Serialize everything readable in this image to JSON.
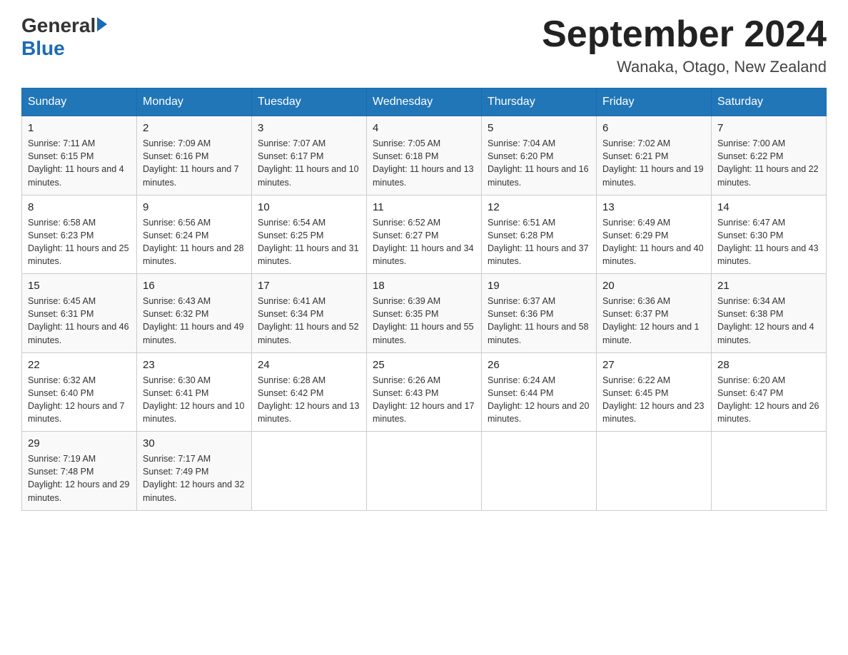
{
  "header": {
    "logo_general": "General",
    "logo_blue": "Blue",
    "month_year": "September 2024",
    "location": "Wanaka, Otago, New Zealand"
  },
  "days_of_week": [
    "Sunday",
    "Monday",
    "Tuesday",
    "Wednesday",
    "Thursday",
    "Friday",
    "Saturday"
  ],
  "weeks": [
    [
      {
        "day": "1",
        "sunrise": "7:11 AM",
        "sunset": "6:15 PM",
        "daylight": "11 hours and 4 minutes."
      },
      {
        "day": "2",
        "sunrise": "7:09 AM",
        "sunset": "6:16 PM",
        "daylight": "11 hours and 7 minutes."
      },
      {
        "day": "3",
        "sunrise": "7:07 AM",
        "sunset": "6:17 PM",
        "daylight": "11 hours and 10 minutes."
      },
      {
        "day": "4",
        "sunrise": "7:05 AM",
        "sunset": "6:18 PM",
        "daylight": "11 hours and 13 minutes."
      },
      {
        "day": "5",
        "sunrise": "7:04 AM",
        "sunset": "6:20 PM",
        "daylight": "11 hours and 16 minutes."
      },
      {
        "day": "6",
        "sunrise": "7:02 AM",
        "sunset": "6:21 PM",
        "daylight": "11 hours and 19 minutes."
      },
      {
        "day": "7",
        "sunrise": "7:00 AM",
        "sunset": "6:22 PM",
        "daylight": "11 hours and 22 minutes."
      }
    ],
    [
      {
        "day": "8",
        "sunrise": "6:58 AM",
        "sunset": "6:23 PM",
        "daylight": "11 hours and 25 minutes."
      },
      {
        "day": "9",
        "sunrise": "6:56 AM",
        "sunset": "6:24 PM",
        "daylight": "11 hours and 28 minutes."
      },
      {
        "day": "10",
        "sunrise": "6:54 AM",
        "sunset": "6:25 PM",
        "daylight": "11 hours and 31 minutes."
      },
      {
        "day": "11",
        "sunrise": "6:52 AM",
        "sunset": "6:27 PM",
        "daylight": "11 hours and 34 minutes."
      },
      {
        "day": "12",
        "sunrise": "6:51 AM",
        "sunset": "6:28 PM",
        "daylight": "11 hours and 37 minutes."
      },
      {
        "day": "13",
        "sunrise": "6:49 AM",
        "sunset": "6:29 PM",
        "daylight": "11 hours and 40 minutes."
      },
      {
        "day": "14",
        "sunrise": "6:47 AM",
        "sunset": "6:30 PM",
        "daylight": "11 hours and 43 minutes."
      }
    ],
    [
      {
        "day": "15",
        "sunrise": "6:45 AM",
        "sunset": "6:31 PM",
        "daylight": "11 hours and 46 minutes."
      },
      {
        "day": "16",
        "sunrise": "6:43 AM",
        "sunset": "6:32 PM",
        "daylight": "11 hours and 49 minutes."
      },
      {
        "day": "17",
        "sunrise": "6:41 AM",
        "sunset": "6:34 PM",
        "daylight": "11 hours and 52 minutes."
      },
      {
        "day": "18",
        "sunrise": "6:39 AM",
        "sunset": "6:35 PM",
        "daylight": "11 hours and 55 minutes."
      },
      {
        "day": "19",
        "sunrise": "6:37 AM",
        "sunset": "6:36 PM",
        "daylight": "11 hours and 58 minutes."
      },
      {
        "day": "20",
        "sunrise": "6:36 AM",
        "sunset": "6:37 PM",
        "daylight": "12 hours and 1 minute."
      },
      {
        "day": "21",
        "sunrise": "6:34 AM",
        "sunset": "6:38 PM",
        "daylight": "12 hours and 4 minutes."
      }
    ],
    [
      {
        "day": "22",
        "sunrise": "6:32 AM",
        "sunset": "6:40 PM",
        "daylight": "12 hours and 7 minutes."
      },
      {
        "day": "23",
        "sunrise": "6:30 AM",
        "sunset": "6:41 PM",
        "daylight": "12 hours and 10 minutes."
      },
      {
        "day": "24",
        "sunrise": "6:28 AM",
        "sunset": "6:42 PM",
        "daylight": "12 hours and 13 minutes."
      },
      {
        "day": "25",
        "sunrise": "6:26 AM",
        "sunset": "6:43 PM",
        "daylight": "12 hours and 17 minutes."
      },
      {
        "day": "26",
        "sunrise": "6:24 AM",
        "sunset": "6:44 PM",
        "daylight": "12 hours and 20 minutes."
      },
      {
        "day": "27",
        "sunrise": "6:22 AM",
        "sunset": "6:45 PM",
        "daylight": "12 hours and 23 minutes."
      },
      {
        "day": "28",
        "sunrise": "6:20 AM",
        "sunset": "6:47 PM",
        "daylight": "12 hours and 26 minutes."
      }
    ],
    [
      {
        "day": "29",
        "sunrise": "7:19 AM",
        "sunset": "7:48 PM",
        "daylight": "12 hours and 29 minutes."
      },
      {
        "day": "30",
        "sunrise": "7:17 AM",
        "sunset": "7:49 PM",
        "daylight": "12 hours and 32 minutes."
      },
      null,
      null,
      null,
      null,
      null
    ]
  ],
  "labels": {
    "sunrise": "Sunrise:",
    "sunset": "Sunset:",
    "daylight": "Daylight:"
  }
}
